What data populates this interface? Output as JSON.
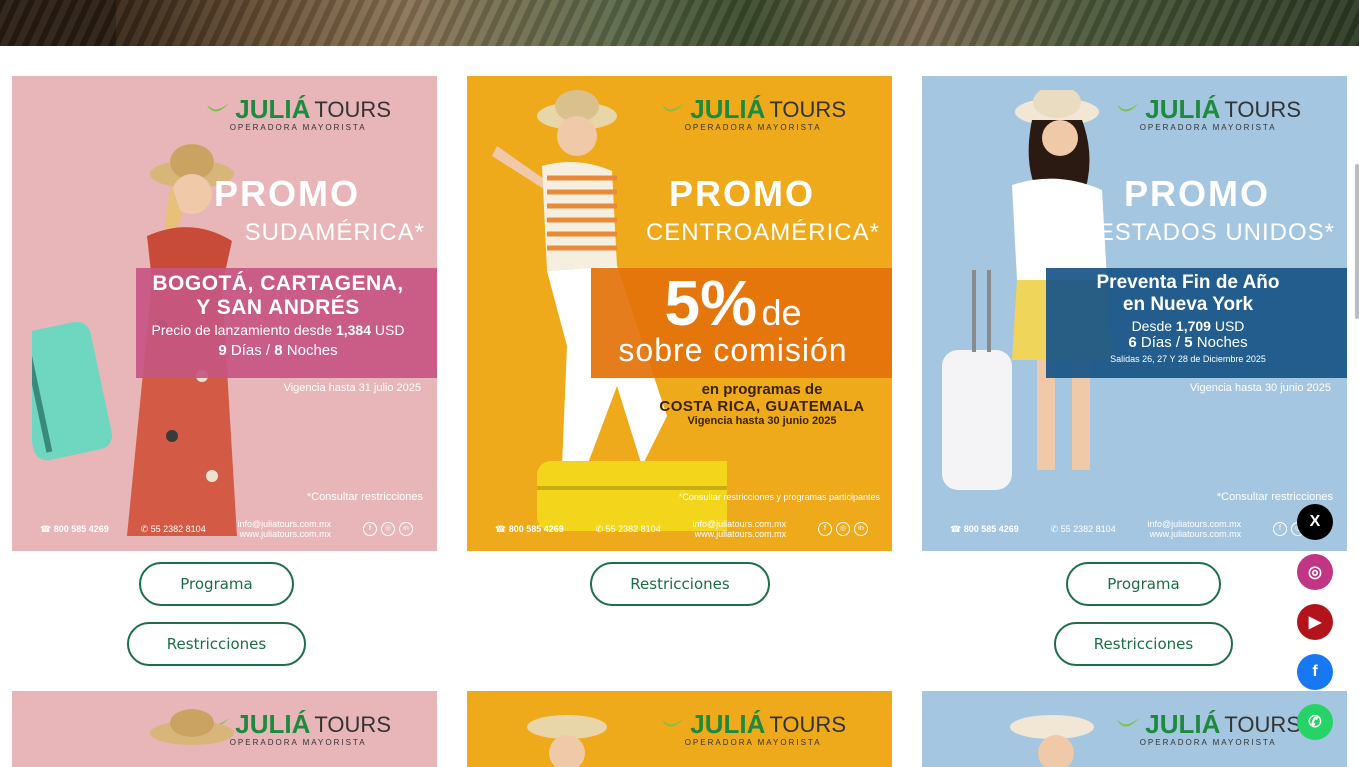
{
  "hero": {
    "image": "mountain-landscape"
  },
  "brand": {
    "name": "JULIÁ",
    "tours": "TOURS",
    "reg": "®",
    "subtitle": "OPERADORA MAYORISTA"
  },
  "cards": [
    {
      "promo": "PROMO",
      "region": "SUDAMÉRICA*",
      "band_title_1": "BOGOTÁ, CARTAGENA,",
      "band_title_2": "Y SAN ANDRÉS",
      "band_price_text": "Precio de lanzamiento desde",
      "band_price_value": "1,384",
      "band_price_unit": "USD",
      "band_days": "9",
      "band_days_label": "Días /",
      "band_nights": "8",
      "band_nights_label": "Noches",
      "validity": "Vigencia hasta 31 julio 2025",
      "restrictions_note": "*Consultar restricciones",
      "phone": "800 585 4269",
      "whatsapp": "55 2382 8104",
      "email": "info@juliatours.com.mx",
      "web": "www.juliatours.com.mx",
      "buttons": [
        "Programa",
        "Restricciones"
      ]
    },
    {
      "promo": "PROMO",
      "region": "CENTROAMÉRICA*",
      "band_big": "5%",
      "band_de": "de",
      "band_line2": "sobre comisión",
      "programs_line1": "en programas de",
      "programs_line2": "COSTA RICA, GUATEMALA",
      "validity": "Vigencia hasta 30 junio 2025",
      "restrictions_note": "*Consultar restricciones y programas participantes",
      "phone": "800 585 4269",
      "whatsapp": "55 2382 8104",
      "email": "info@juliatours.com.mx",
      "web": "www.juliatours.com.mx",
      "buttons": [
        "Restricciones"
      ]
    },
    {
      "promo": "PROMO",
      "region": "ESTADOS UNIDOS*",
      "band_title_1": "Preventa Fin de Año",
      "band_title_2": "en Nueva York",
      "band_price_text": "Desde",
      "band_price_value": "1,709",
      "band_price_unit": "USD",
      "band_days": "6",
      "band_days_label": "Días /",
      "band_nights": "5",
      "band_nights_label": "Noches",
      "band_departures": "Salidas 26, 27 Y 28 de Diciembre 2025",
      "validity": "Vigencia hasta 30 junio 2025",
      "restrictions_note": "*Consultar restricciones",
      "phone": "800 585 4269",
      "whatsapp": "55 2382 8104",
      "email": "info@juliatours.com.mx",
      "web": "www.juliatours.com.mx",
      "buttons": [
        "Programa",
        "Restricciones"
      ]
    }
  ],
  "social": [
    {
      "name": "x-icon",
      "glyph": "X",
      "color": "#000000"
    },
    {
      "name": "instagram-icon",
      "glyph": "◎",
      "color": "#c13584"
    },
    {
      "name": "youtube-icon",
      "glyph": "▶",
      "color": "#b3141b"
    },
    {
      "name": "facebook-icon",
      "glyph": "f",
      "color": "#1877f2"
    },
    {
      "name": "whatsapp-icon",
      "glyph": "✆",
      "color": "#25d366"
    }
  ],
  "colors": {
    "pink": "#e8b6b8",
    "yellow": "#eeaa1a",
    "blue": "#a5c6e0",
    "button_border": "#1e6e4a"
  }
}
